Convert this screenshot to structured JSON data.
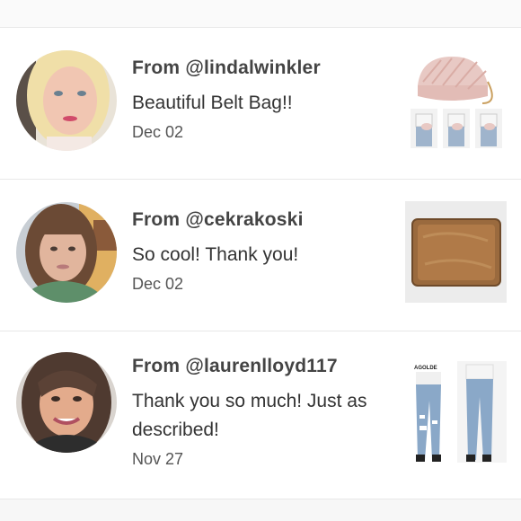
{
  "feed": {
    "items": [
      {
        "from": "From @lindalwinkler",
        "message": "Beautiful Belt Bag!!",
        "date": "Dec 02"
      },
      {
        "from": "From @cekrakoski",
        "message": "So cool! Thank you!",
        "date": "Dec 02"
      },
      {
        "from": "From @laurenlloyd117",
        "message": "Thank you so much! Just as described!",
        "date": "Nov 27"
      }
    ],
    "brand_label": "AGOLDE"
  }
}
